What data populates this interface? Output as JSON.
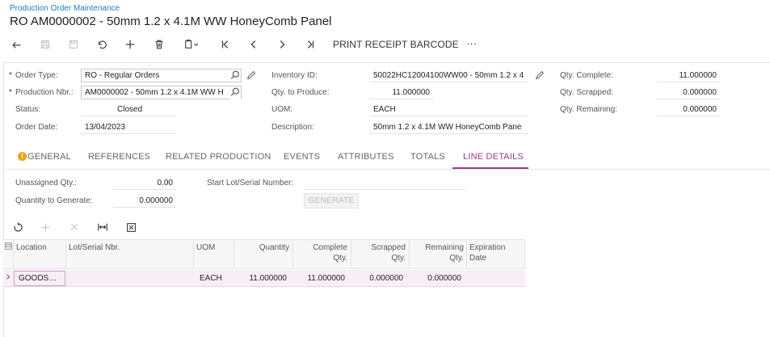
{
  "breadcrumb": "Production Order Maintenance",
  "title": "RO AM0000002 - 50mm 1.2 x 4.1M WW HoneyComb Panel",
  "toolbar": {
    "print_receipt_barcode": "PRINT RECEIPT BARCODE",
    "more": "···"
  },
  "form": {
    "order_type": {
      "label": "Order Type:",
      "value": "RO - Regular Orders"
    },
    "production_nbr": {
      "label": "Production Nbr.:",
      "value": "AM0000002 - 50mm 1.2 x 4.1M WW H"
    },
    "status": {
      "label": "Status:",
      "value": "Closed"
    },
    "order_date": {
      "label": "Order Date:",
      "value": "13/04/2023"
    },
    "inventory_id": {
      "label": "Inventory ID:",
      "value": "50022HC12004100WW00 - 50mm 1.2 x 4"
    },
    "qty_to_produce": {
      "label": "Qty. to Produce:",
      "value": "11.000000"
    },
    "uom": {
      "label": "UOM:",
      "value": "EACH"
    },
    "description": {
      "label": "Description:",
      "value": "50mm 1.2 x 4.1M WW HoneyComb Pane"
    },
    "qty_complete": {
      "label": "Qty. Complete:",
      "value": "11.000000"
    },
    "qty_scrapped": {
      "label": "Qty. Scrapped:",
      "value": "0.000000"
    },
    "qty_remaining": {
      "label": "Qty. Remaining:",
      "value": "0.000000"
    },
    "required_marker": "*"
  },
  "tabs": {
    "general": "GENERAL",
    "general_badge": "!",
    "references": "REFERENCES",
    "related_production": "RELATED PRODUCTION",
    "events": "EVENTS",
    "attributes": "ATTRIBUTES",
    "totals": "TOTALS",
    "line_details": "LINE DETAILS"
  },
  "line_details": {
    "unassigned_qty": {
      "label": "Unassigned Qty.:",
      "value": "0.00"
    },
    "qty_to_generate": {
      "label": "Quantity to Generate:",
      "value": "0.000000"
    },
    "start_lot_serial": {
      "label": "Start Lot/Serial Number:",
      "value": ""
    },
    "generate_button": "GENERATE"
  },
  "grid": {
    "columns": {
      "location": "Location",
      "lot_serial": "Lot/Serial Nbr.",
      "uom": "UOM",
      "quantity": "Quantity",
      "complete_qty_1": "Complete",
      "complete_qty_2": "Qty.",
      "scrapped_qty_1": "Scrapped",
      "scrapped_qty_2": "Qty.",
      "remaining_qty_1": "Remaining",
      "remaining_qty_2": "Qty.",
      "expiration_1": "Expiration",
      "expiration_2": "Date"
    },
    "rows": [
      {
        "location": "GOODS…",
        "lot_serial": "",
        "uom": "EACH",
        "quantity": "11.000000",
        "complete_qty": "11.000000",
        "scrapped_qty": "0.000000",
        "remaining_qty": "0.000000",
        "expiration": ""
      }
    ]
  },
  "colors": {
    "accent": "#9b3a8f",
    "link": "#1a7fc1",
    "row_highlight": "#f7eef6"
  }
}
